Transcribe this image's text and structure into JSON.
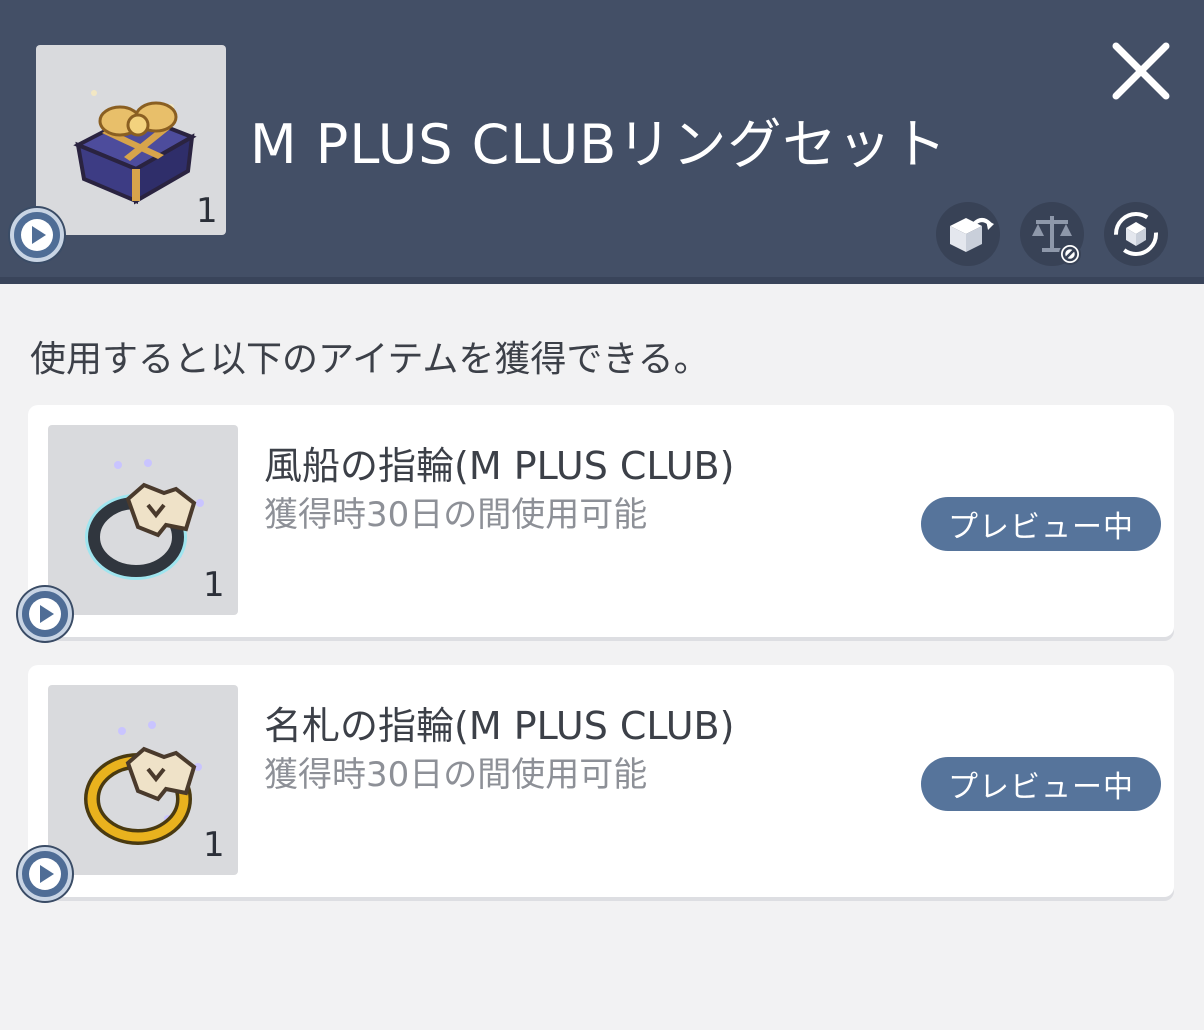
{
  "header": {
    "title": "M PLUS CLUBリングセット",
    "quantity": "1",
    "main_icon": "gift-box-icon",
    "actions": [
      {
        "icon": "transfer-box-icon"
      },
      {
        "icon": "no-trade-scale-icon"
      },
      {
        "icon": "exchange-cycle-icon"
      }
    ],
    "close_icon": "close-icon"
  },
  "description": "使用すると以下のアイテムを獲得できる。",
  "items": [
    {
      "name": "風船の指輪(M PLUS CLUB)",
      "sub": "獲得時30日の間使用可能",
      "quantity": "1",
      "icon": "silver-ring-icon",
      "button_label": "プレビュー中"
    },
    {
      "name": "名札の指輪(M PLUS CLUB)",
      "sub": "獲得時30日の間使用可能",
      "quantity": "1",
      "icon": "gold-ring-icon",
      "button_label": "プレビュー中"
    }
  ],
  "colors": {
    "header_bg": "#434f66",
    "page_bg": "#f2f2f3",
    "button_bg": "#56749b",
    "badge": "#4f6d96"
  }
}
